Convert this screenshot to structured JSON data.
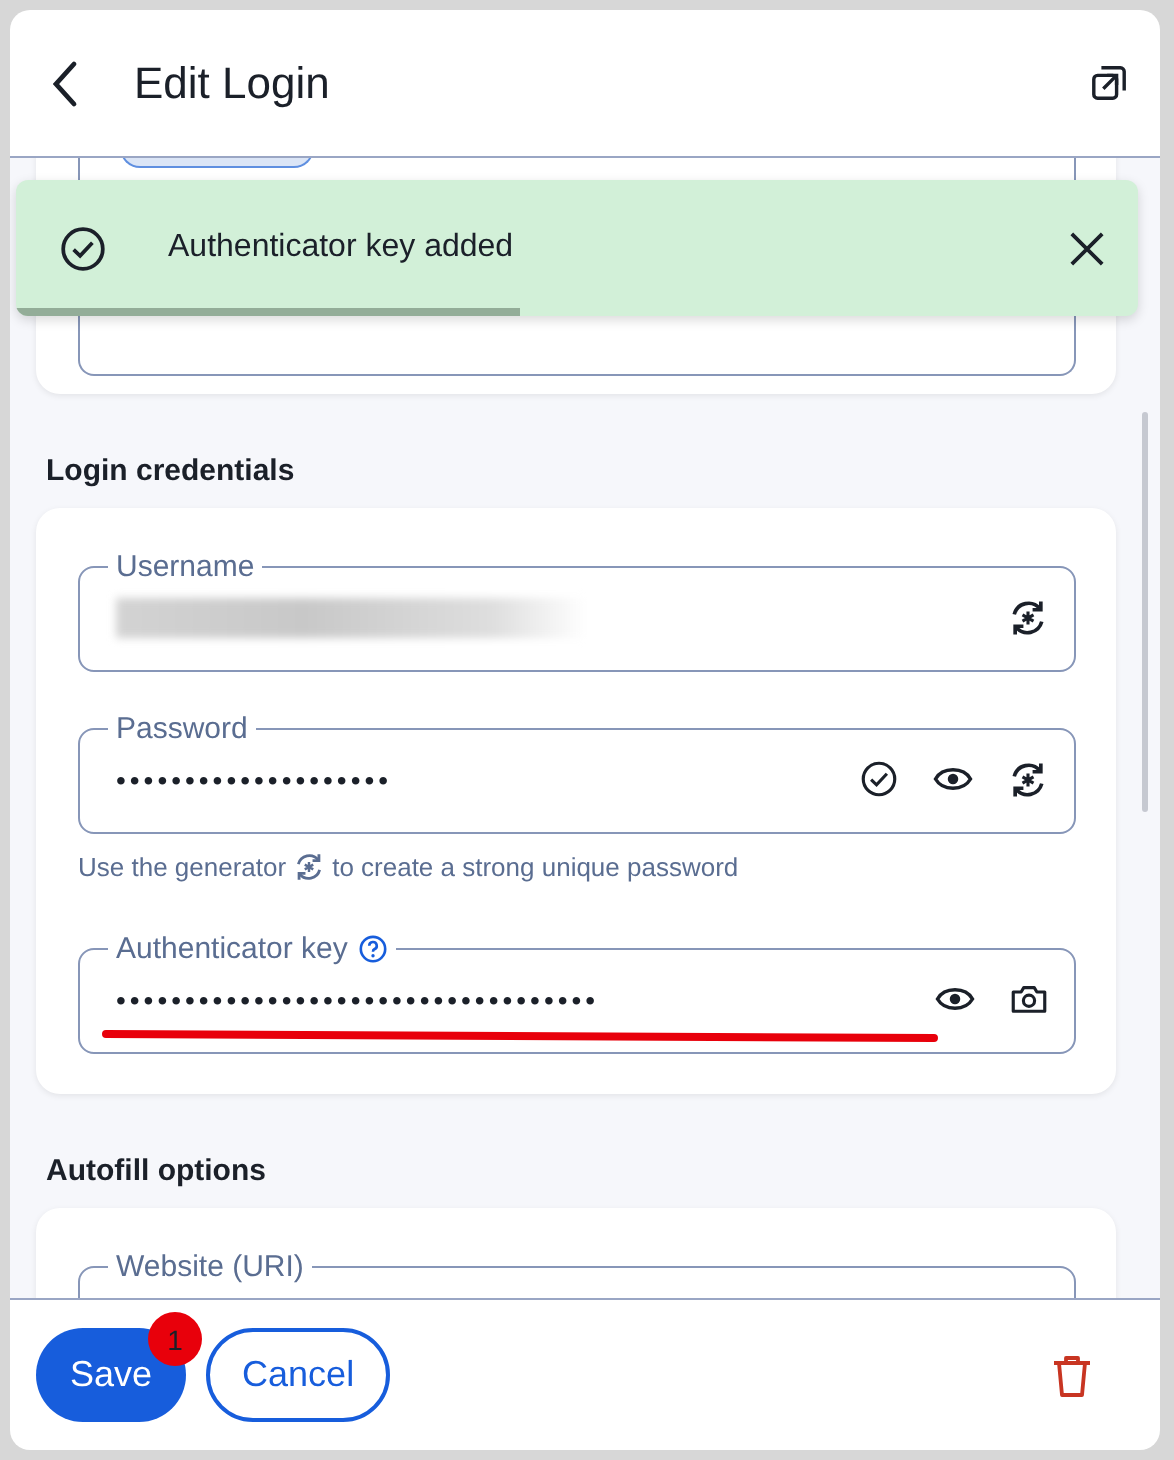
{
  "header": {
    "title": "Edit Login"
  },
  "toast": {
    "message": "Authenticator key added",
    "level": 0.45
  },
  "sections": [
    {
      "heading": "Login credentials",
      "fields": [
        {
          "label": "Username",
          "value_blurred": true,
          "help": false,
          "actions": [
            {
              "kind": "generate"
            }
          ]
        },
        {
          "label": "Password",
          "value": "••••••••••••••••••••",
          "help": false,
          "actions": [
            {
              "kind": "check"
            },
            {
              "kind": "show"
            },
            {
              "kind": "generate"
            }
          ],
          "hint_before": "Use the generator",
          "hint_after": "to create a strong unique password"
        },
        {
          "label": "Authenticator key",
          "value": "•••••••••••••••••••••••••••••••••••",
          "help": true,
          "underlined": true,
          "actions": [
            {
              "kind": "show"
            },
            {
              "kind": "camera"
            }
          ]
        }
      ]
    },
    {
      "heading": "Autofill options",
      "fields": [
        {
          "label": "Website (URI)",
          "help": false
        }
      ]
    }
  ],
  "footer": {
    "save": "Save",
    "badge": "1",
    "cancel": "Cancel"
  }
}
